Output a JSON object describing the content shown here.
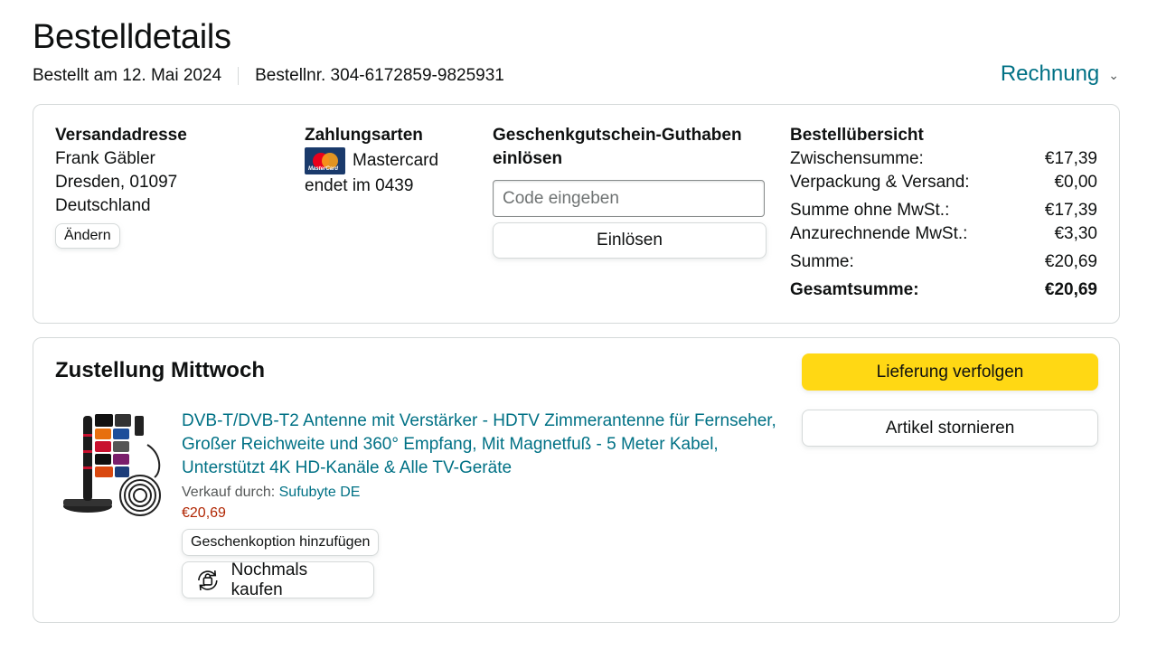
{
  "page": {
    "title": "Bestelldetails",
    "order_date": "Bestellt am 12. Mai 2024",
    "order_number": "Bestellnr. 304-6172859-9825931",
    "invoice_label": "Rechnung"
  },
  "shipping": {
    "heading": "Versandadresse",
    "name": "Frank Gäbler",
    "city": "Dresden, 01097",
    "country": "Deutschland",
    "change_label": "Ändern"
  },
  "payment": {
    "heading": "Zahlungsarten",
    "card_name": "Mastercard",
    "card_ending": "endet im 0439",
    "logo_text": "MasterCard"
  },
  "gift_card": {
    "heading": "Geschenkgutschein-Guthaben einlösen",
    "placeholder": "Code eingeben",
    "redeem_label": "Einlösen"
  },
  "summary": {
    "heading": "Bestellübersicht",
    "rows": [
      {
        "label": "Zwischensumme:",
        "value": "€17,39"
      },
      {
        "label": "Verpackung & Versand:",
        "value": "€0,00"
      },
      {
        "label": "Summe ohne MwSt.:",
        "value": "€17,39"
      },
      {
        "label": "Anzurechnende MwSt.:",
        "value": "€3,30"
      },
      {
        "label": "Summe:",
        "value": "€20,69"
      },
      {
        "label": "Gesamtsumme:",
        "value": "€20,69"
      }
    ]
  },
  "delivery": {
    "title": "Zustellung Mittwoch",
    "track_label": "Lieferung verfolgen",
    "cancel_label": "Artikel stornieren",
    "item": {
      "title": "DVB-T/DVB-T2 Antenne mit Verstärker - HDTV Zimmerantenne für Fernseher, Großer Reichweite und 360° Empfang, Mit Magnetfuß - 5 Meter Kabel, Unterstützt 4K HD-Kanäle & Alle TV-Geräte",
      "seller_prefix": "Verkauf durch:",
      "seller_name": "Sufubyte DE",
      "price": "€20,69",
      "gift_label": "Geschenkoption hinzufügen",
      "buy_again_label": "Nochmals kaufen"
    }
  },
  "colors": {
    "link": "#007185",
    "price": "#b12704",
    "primary_button": "#ffd814",
    "border": "#d5d9d9"
  }
}
